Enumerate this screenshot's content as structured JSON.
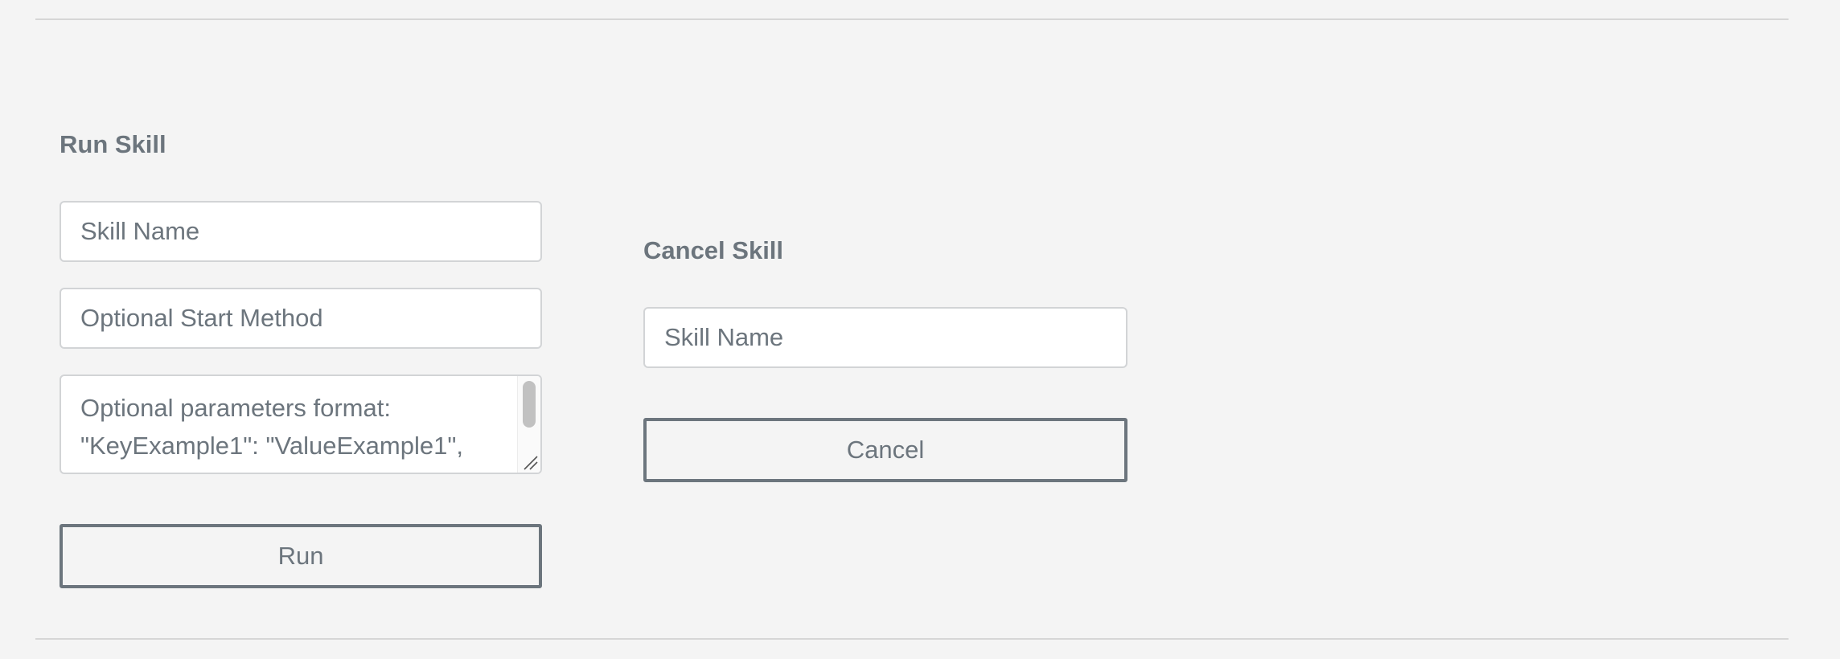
{
  "run_skill": {
    "heading": "Run Skill",
    "skill_name_placeholder": "Skill Name",
    "start_method_placeholder": "Optional Start Method",
    "parameters_placeholder": "Optional parameters format:\n\"KeyExample1\": \"ValueExample1\",",
    "run_button_label": "Run"
  },
  "cancel_skill": {
    "heading": "Cancel Skill",
    "skill_name_placeholder": "Skill Name",
    "cancel_button_label": "Cancel"
  },
  "icons": {
    "scrollbar": "scrollbar-thumb",
    "resize": "resize-handle-icon"
  }
}
